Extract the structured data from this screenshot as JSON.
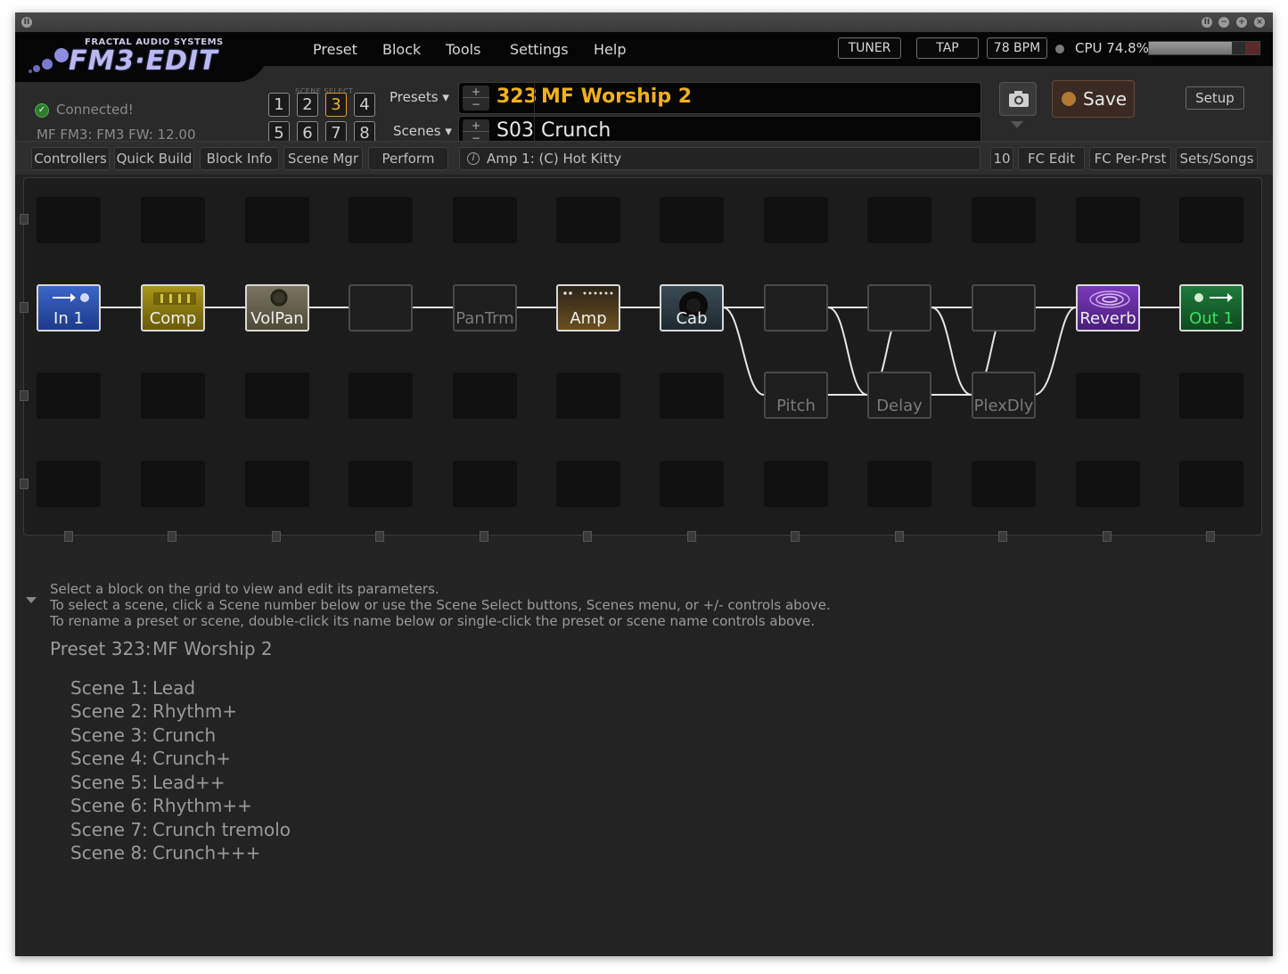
{
  "logo": {
    "company": "FRACTAL AUDIO SYSTEMS",
    "product": "FM3·EDIT"
  },
  "menu": [
    "Preset",
    "Block",
    "Tools",
    "Settings",
    "Help"
  ],
  "topbar": {
    "tuner": "TUNER",
    "tap": "TAP",
    "bpm": "78 BPM",
    "cpu": "CPU 74.8%",
    "cpu_percent": 74.8
  },
  "status": {
    "connected": "Connected!",
    "firmware": "MF FM3: FM3 FW: 12.00"
  },
  "scene_select": {
    "label": "SCENE SELECT",
    "buttons": [
      "1",
      "2",
      "3",
      "4",
      "5",
      "6",
      "7",
      "8"
    ],
    "active": "3"
  },
  "presets_dropdown": "Presets",
  "scenes_dropdown": "Scenes",
  "current_preset": {
    "number": "323",
    "name": "MF Worship 2"
  },
  "current_scene": {
    "number": "S03",
    "name": "Crunch"
  },
  "plus_minus": {
    "plus": "+",
    "minus": "−"
  },
  "save_label": "Save",
  "setup_label": "Setup",
  "toolbar": {
    "left": [
      "Controllers",
      "Quick Build",
      "Block Info",
      "Scene Mgr",
      "Perform"
    ],
    "info": "Amp 1: (C) Hot Kitty",
    "right": [
      "10",
      "FC Edit",
      "FC Per-Prst",
      "Sets/Songs"
    ]
  },
  "blocks": {
    "in": "In 1",
    "comp": "Comp",
    "volpan": "VolPan",
    "pantrm": "PanTrm",
    "amp": "Amp",
    "cab": "Cab",
    "pitch": "Pitch",
    "delay": "Delay",
    "plexdly": "PlexDly",
    "reverb": "Reverb",
    "out": "Out 1"
  },
  "colors": {
    "accent": "#f0b020",
    "in": "#2b4fa8",
    "comp": "#8a7a10",
    "volpan": "#6b6650",
    "amp": "#5a4418",
    "cab": "#2a3a44",
    "reverb": "#5a2a8a",
    "out": "#1e6a34",
    "out_text": "#40e060"
  },
  "hints": [
    "Select a block on the grid to view and edit its parameters.",
    "To select a scene, click a Scene number below or use the Scene Select buttons, Scenes menu, or +/- controls above.",
    "To rename a preset or scene, double-click its name below or single-click the preset or scene name controls above."
  ],
  "preset_summary": {
    "label": "Preset 323:",
    "name": "MF Worship 2"
  },
  "scenes": [
    {
      "label": "Scene 1:",
      "name": "Lead"
    },
    {
      "label": "Scene 2:",
      "name": "Rhythm+"
    },
    {
      "label": "Scene 3:",
      "name": "Crunch"
    },
    {
      "label": "Scene 4:",
      "name": "Crunch+"
    },
    {
      "label": "Scene 5:",
      "name": "Lead++"
    },
    {
      "label": "Scene 6:",
      "name": "Rhythm++"
    },
    {
      "label": "Scene 7:",
      "name": "Crunch tremolo"
    },
    {
      "label": "Scene 8:",
      "name": "Crunch+++"
    }
  ]
}
